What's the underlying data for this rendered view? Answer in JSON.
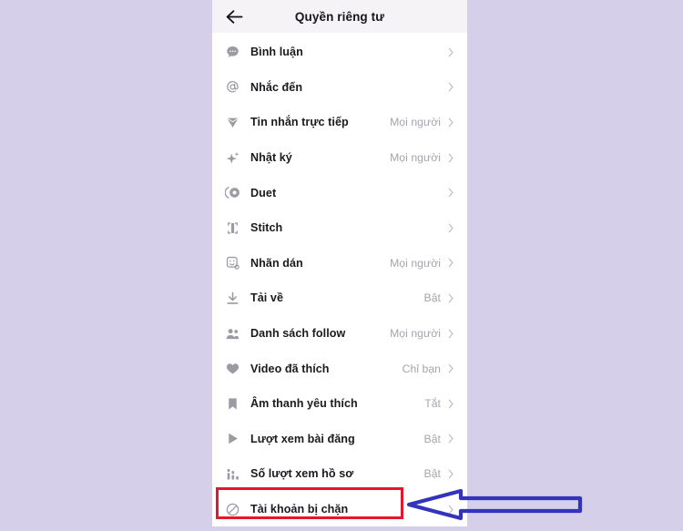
{
  "header": {
    "title": "Quyền riêng tư",
    "back_icon": "arrow-left-icon"
  },
  "settings": {
    "items": [
      {
        "label": "Bình luận",
        "value": "",
        "icon": "comment-bubble-icon"
      },
      {
        "label": "Nhắc đến",
        "value": "",
        "icon": "at-mention-icon"
      },
      {
        "label": "Tin nhắn trực tiếp",
        "value": "Mọi người",
        "icon": "paper-plane-icon"
      },
      {
        "label": "Nhật ký",
        "value": "Mọi người",
        "icon": "sparkle-icon"
      },
      {
        "label": "Duet",
        "value": "",
        "icon": "duet-icon"
      },
      {
        "label": "Stitch",
        "value": "",
        "icon": "stitch-icon"
      },
      {
        "label": "Nhãn dán",
        "value": "Mọi người",
        "icon": "sticker-icon"
      },
      {
        "label": "Tải về",
        "value": "Bật",
        "icon": "download-icon"
      },
      {
        "label": "Danh sách follow",
        "value": "Mọi người",
        "icon": "people-icon"
      },
      {
        "label": "Video đã thích",
        "value": "Chỉ bạn",
        "icon": "heart-icon"
      },
      {
        "label": "Âm thanh yêu thích",
        "value": "Tắt",
        "icon": "bookmark-icon"
      },
      {
        "label": "Lượt xem bài đăng",
        "value": "Bật",
        "icon": "play-triangle-icon"
      },
      {
        "label": "Số lượt xem hồ sơ",
        "value": "Bật",
        "icon": "bar-chart-icon"
      },
      {
        "label": "Tài khoản bị chặn",
        "value": "",
        "icon": "blocked-circle-icon"
      }
    ],
    "chevron_icon": "chevron-right-icon"
  },
  "annotations": {
    "highlight_color": "#e8162a",
    "arrow_color": "#3333bb",
    "highlight_target": "Tài khoản bị chặn",
    "arrow_icon": "left-pointing-arrow-icon"
  },
  "theme": {
    "background": "#d5cfea",
    "panel_background": "#ffffff",
    "header_background": "#f5f3f6",
    "label_color": "#1b1a1f",
    "value_color": "#a6a3ae",
    "icon_color": "#9d9aa3"
  }
}
